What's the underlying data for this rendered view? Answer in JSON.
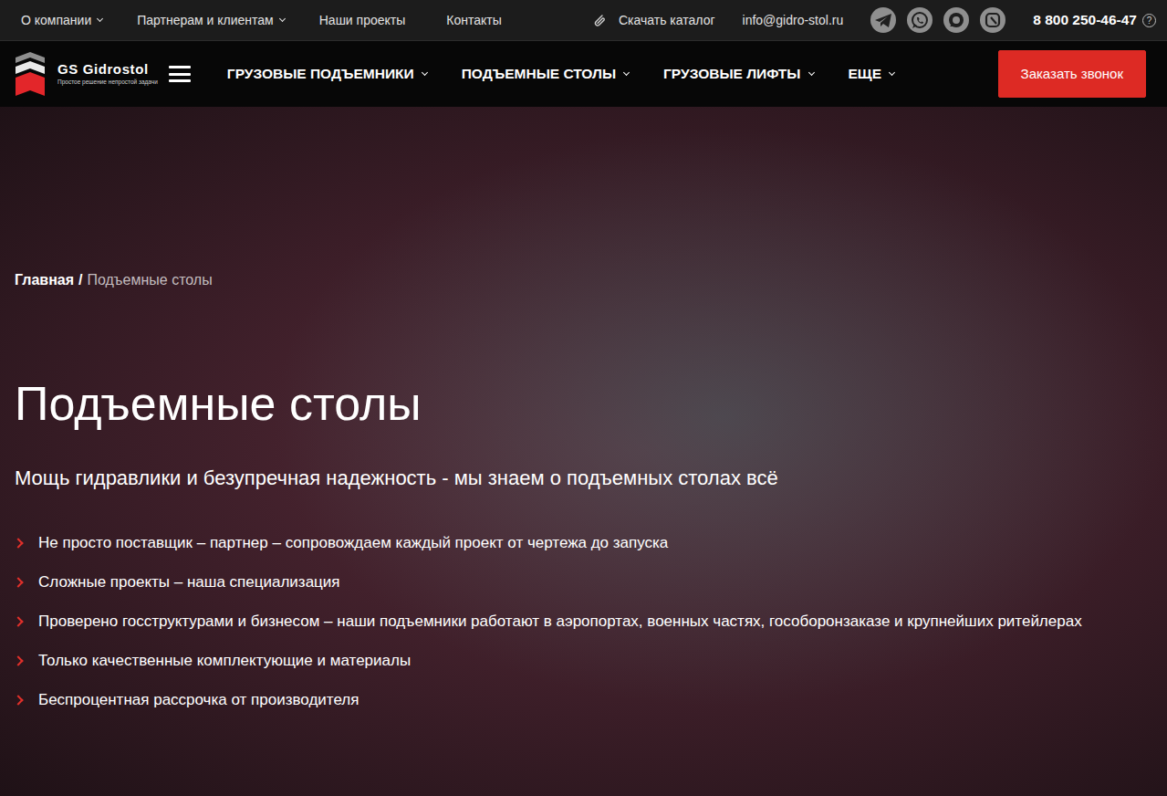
{
  "topbar": {
    "links": [
      {
        "label": "О компании",
        "has_menu": true
      },
      {
        "label": "Партнерам и клиентам",
        "has_menu": true
      },
      {
        "label": "Наши проекты",
        "has_menu": false
      },
      {
        "label": "Контакты",
        "has_menu": false
      }
    ],
    "catalog": "Скачать каталог",
    "email": "info@gidro-stol.ru",
    "phone": "8 800 250-46-47",
    "phone_help": "?"
  },
  "header": {
    "brand": "GS Gidrostol",
    "tagline": "Простое решение непростой задачи",
    "menu": [
      {
        "label": "ГРУЗОВЫЕ ПОДЪЕМНИКИ",
        "has_menu": true
      },
      {
        "label": "ПОДЪЕМНЫЕ СТОЛЫ",
        "has_menu": true
      },
      {
        "label": "ГРУЗОВЫЕ ЛИФТЫ",
        "has_menu": true
      },
      {
        "label": "ЕЩЕ",
        "has_menu": true
      }
    ],
    "cta": "Заказать звонок"
  },
  "hero": {
    "breadcrumb": {
      "separator": "/",
      "items": [
        {
          "label": "Главная",
          "current": false
        },
        {
          "label": "Подъемные столы",
          "current": true
        }
      ]
    },
    "title": "Подъемные столы",
    "subtitle": "Мощь гидравлики и безупречная надежность - мы знаем о подъемных столах всё",
    "bullets": [
      "Не просто поставщик – партнер – сопровождаем каждый проект от чертежа до запуска",
      "Сложные проекты – наша специализация",
      "Проверено госструктурами и бизнесом – наши подъемники работают в аэропортах, военных частях, гособоронзаказе и крупнейших ритейлерах",
      "Только качественные комплектующие и материалы",
      "Беспроцентная рассрочка от производителя"
    ]
  }
}
